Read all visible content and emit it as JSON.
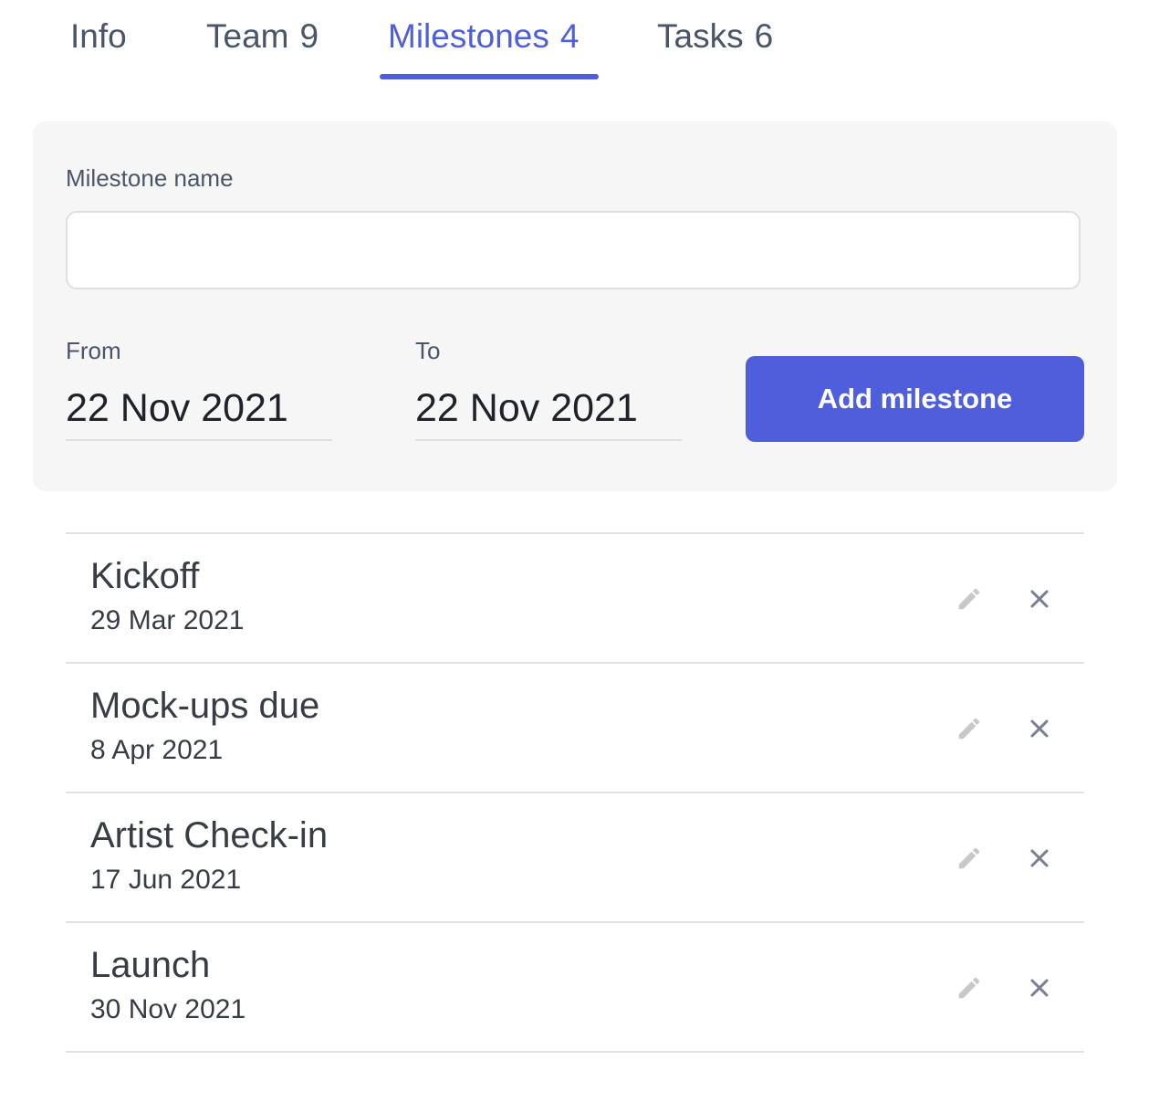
{
  "tabs": [
    {
      "label": "Info",
      "count": ""
    },
    {
      "label": "Team",
      "count": "9"
    },
    {
      "label": "Milestones",
      "count": "4",
      "active": true
    },
    {
      "label": "Tasks",
      "count": "6"
    }
  ],
  "form": {
    "name_label": "Milestone name",
    "name_value": "",
    "from_label": "From",
    "from_value": "22 Nov 2021",
    "to_label": "To",
    "to_value": "22 Nov 2021",
    "add_button_label": "Add milestone"
  },
  "milestones": [
    {
      "name": "Kickoff",
      "date": "29 Mar 2021"
    },
    {
      "name": "Mock-ups due",
      "date": "8 Apr 2021"
    },
    {
      "name": "Artist Check-in",
      "date": "17 Jun 2021"
    },
    {
      "name": "Launch",
      "date": "30 Nov 2021"
    }
  ],
  "icons": {
    "edit": "pencil-icon",
    "delete": "close-icon"
  },
  "colors": {
    "accent": "#4f5fd9",
    "button": "#4f5fdc",
    "panel": "#f6f6f7",
    "edit_icon": "#c8c8c8",
    "delete_icon": "#7a7f93"
  }
}
